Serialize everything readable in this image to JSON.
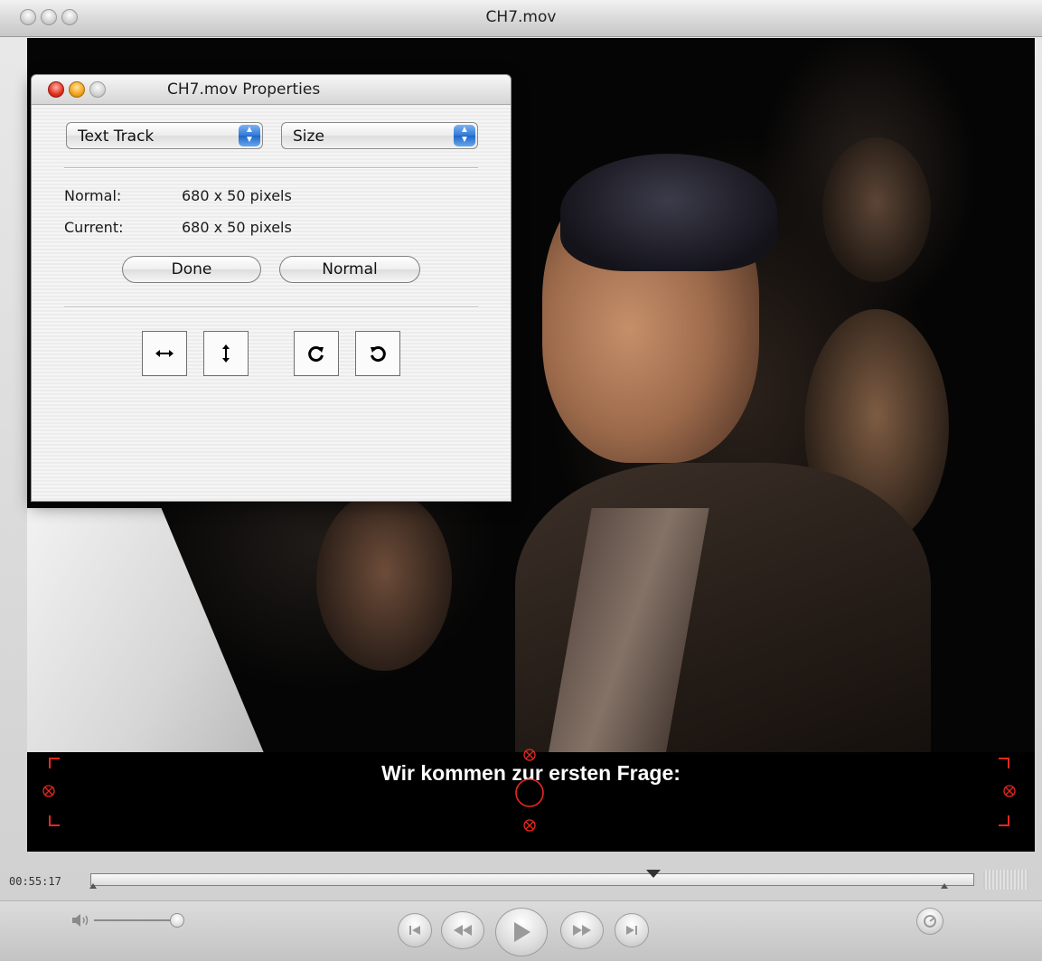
{
  "window": {
    "title": "CH7.mov"
  },
  "video": {
    "subtitle": "Wir kommen zur ersten Frage:"
  },
  "controls": {
    "current_time": "00:55:17",
    "playhead_position": 0.637,
    "volume_level": 1.0
  },
  "properties_panel": {
    "title": "CH7.mov Properties",
    "track_popup": "Text Track",
    "property_popup": "Size",
    "normal_label": "Normal:",
    "normal_value": "680 x 50 pixels",
    "current_label": "Current:",
    "current_value": "680 x 50 pixels",
    "done_button": "Done",
    "normal_button": "Normal",
    "tools": [
      "flip-horizontal-icon",
      "flip-vertical-icon",
      "rotate-clockwise-icon",
      "rotate-counterclockwise-icon"
    ]
  },
  "colors": {
    "handle_red": "#e8281e",
    "popup_blue": "#2f79d9"
  }
}
